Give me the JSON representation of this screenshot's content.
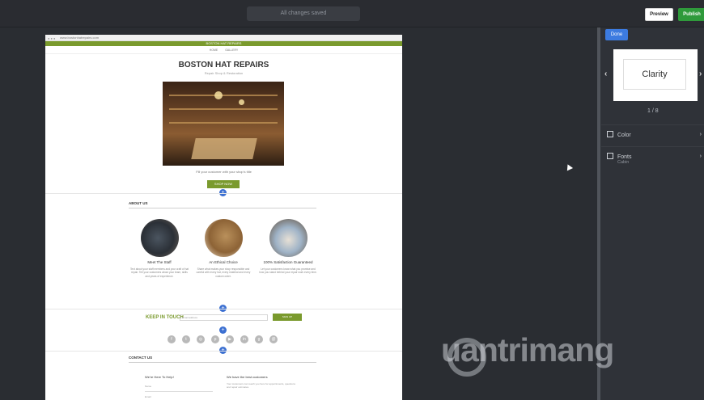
{
  "app": {
    "center_text": "All changes saved",
    "preview_label": "Preview",
    "publish_label": "Publish"
  },
  "site": {
    "brand": "BOSTON HAT REPAIRS",
    "nav": [
      "HOME",
      "GALLERY"
    ],
    "title": "BOSTON HAT REPAIRS",
    "subtitle": "Repair Shop & Restoration",
    "caption": "Fill your customer with your shop’s title",
    "shop_now": "SHOP NOW",
    "about_heading": "ABOUT US",
    "columns": [
      {
        "title": "Meet The Staff",
        "text": "Text about your staff members and your craft of hat repair. Tell your customers about your team, skills and years of experience."
      },
      {
        "title": "An Ethical Choice",
        "text": "Share what makes your shop responsible and careful with every hat, every material and every custom order."
      },
      {
        "title": "100% Satisfaction Guaranteed",
        "text": "Let your customers know what you promise and how you stand behind your repair work every time."
      }
    ],
    "keep_in_touch": "KEEP IN TOUCH",
    "email_placeholder": "Email address",
    "sign_up": "SIGN UP",
    "contact_heading": "CONTACT US",
    "contact_left": "We're Here To Help!",
    "contact_right": "We have the best customers",
    "form_name": "Name",
    "form_email": "Email"
  },
  "sidebar": {
    "done_label": "Done",
    "theme_name": "Clarity",
    "counter": "1 / 8",
    "color_label": "Color",
    "fonts_label": "Fonts",
    "fonts_value": "Cabin"
  },
  "watermark": {
    "text": "uantrimang"
  },
  "colors": {
    "accent": "#7a9a2d",
    "blue": "#3c7be0",
    "publish": "#2f9a3b"
  }
}
